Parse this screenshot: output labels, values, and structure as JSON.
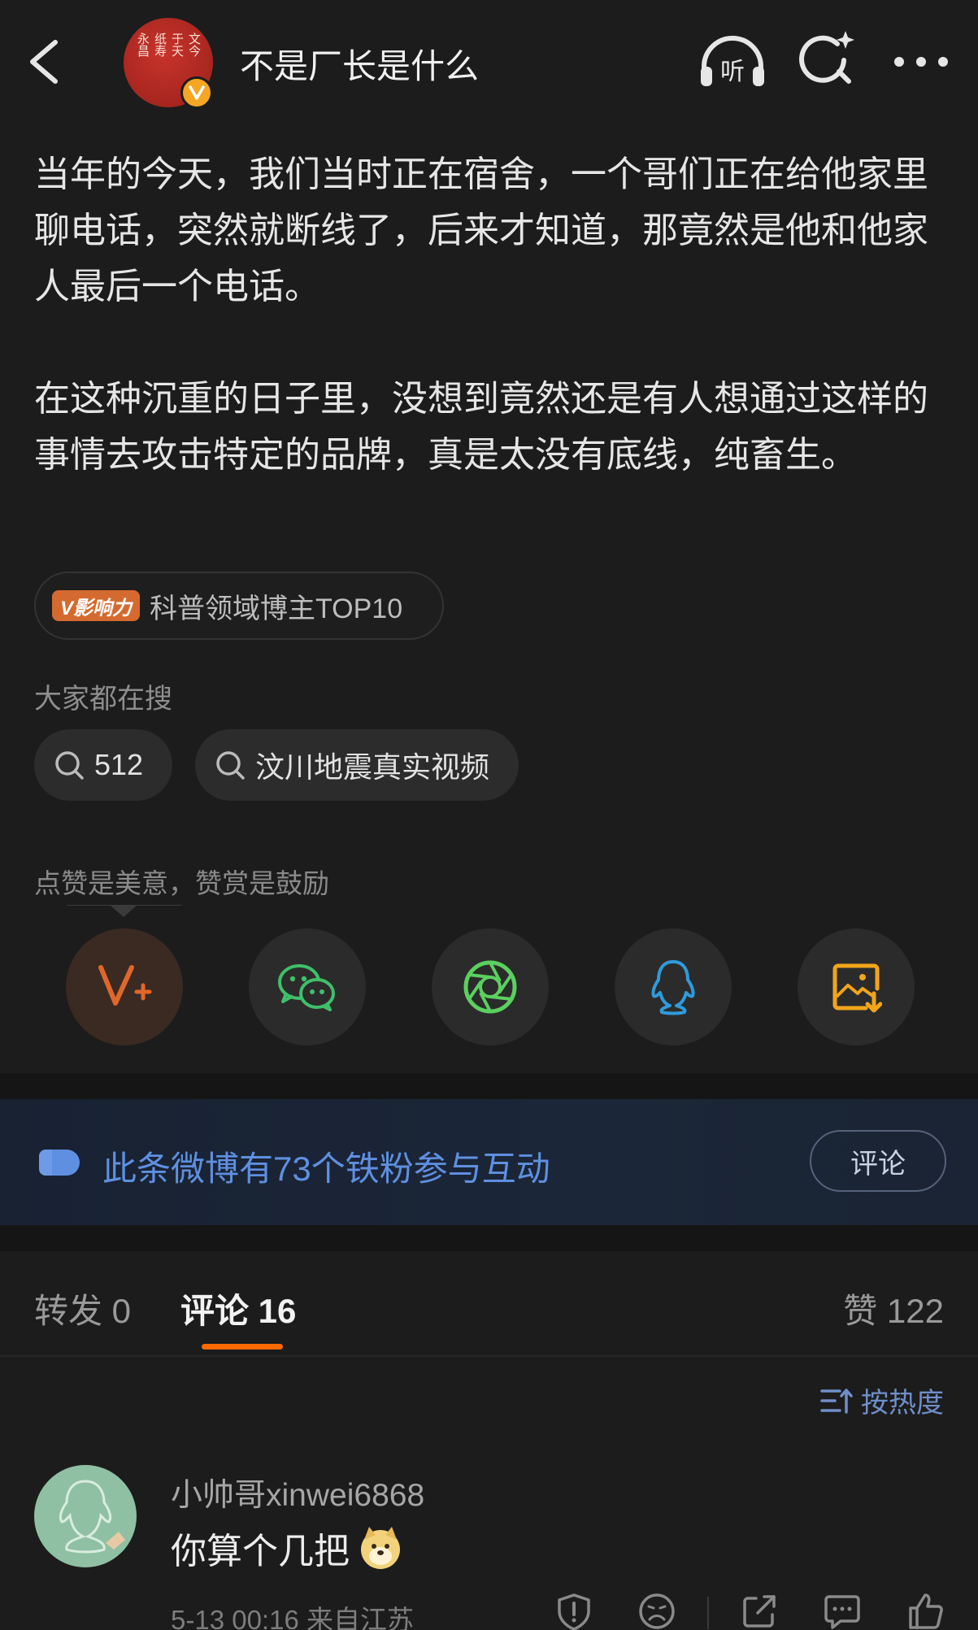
{
  "header": {
    "title": "不是厂长是什么",
    "avatar_seal_lines": [
      "文",
      "今",
      "于",
      "天",
      "纸",
      "寿",
      "永",
      "昌"
    ],
    "listen_label": "听"
  },
  "post": {
    "paragraphs": [
      "当年的今天，我们当时正在宿舍，一个哥们正在给他家里聊电话，突然就断线了，后来才知道，那竟然是他和他家人最后一个电话。",
      "在这种沉重的日子里，没想到竟然还是有人想通过这样的事情去攻击特定的品牌，真是太没有底线，纯畜生。"
    ]
  },
  "influence": {
    "badge": "V影响力",
    "label": "科普领域博主TOP10"
  },
  "search": {
    "heading": "大家都在搜",
    "chips": [
      "512",
      "汶川地震真实视频"
    ]
  },
  "reward": {
    "text": "点赞是美意，赞赏是鼓励"
  },
  "share_targets": [
    "weibo-plus",
    "wechat",
    "moments",
    "qq",
    "save-image"
  ],
  "colors": {
    "accent": "#ff6a00",
    "fans_blue": "#5f8fe0",
    "wechat_green": "#3fbf6a",
    "moments_green": "#5bd05f",
    "qq_blue": "#2f9bdb",
    "save_yellow": "#f2a51b",
    "weibo_orange": "#e0672b"
  },
  "fans": {
    "text": "此条微博有73个铁粉参与互动",
    "button": "评论"
  },
  "tabs": {
    "repost": "转发 0",
    "comments": "评论 16",
    "likes": "赞 122"
  },
  "sort": {
    "label": "按热度"
  },
  "comment": {
    "user": "小帅哥xinwei6868",
    "text": "你算个几把",
    "meta": "5-13 00:16  来自江苏"
  }
}
